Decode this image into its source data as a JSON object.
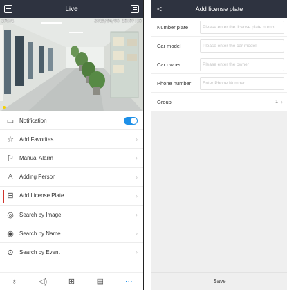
{
  "left": {
    "header": {
      "title": "Live"
    },
    "video": {
      "osd_left": "IPC01",
      "osd_right": "2019/04/06 16:07:55"
    },
    "menu": [
      {
        "label": "Notification",
        "icon": "notification-icon",
        "glyph": "▭"
      },
      {
        "label": "Add Favorites",
        "icon": "star-icon",
        "glyph": "☆"
      },
      {
        "label": "Manual Alarm",
        "icon": "alarm-icon",
        "glyph": "⚐"
      },
      {
        "label": "Adding Person",
        "icon": "person-icon",
        "glyph": "♙"
      },
      {
        "label": "Add License Plate",
        "icon": "car-plate-icon",
        "glyph": "⊟"
      },
      {
        "label": "Search by Image",
        "icon": "image-search-icon",
        "glyph": "◎"
      },
      {
        "label": "Search by Name",
        "icon": "name-search-icon",
        "glyph": "◉"
      },
      {
        "label": "Search by Event",
        "icon": "event-search-icon",
        "glyph": "⊙"
      }
    ],
    "bottombar": [
      {
        "name": "microphone-icon",
        "glyph": "♁"
      },
      {
        "name": "speaker-icon",
        "glyph": "◁)"
      },
      {
        "name": "split-screen-icon",
        "glyph": "⊞"
      },
      {
        "name": "playback-icon",
        "glyph": "▤"
      },
      {
        "name": "more-icon",
        "glyph": "⋯"
      }
    ],
    "accent": "#1e90e8",
    "highlight": "#d0342c"
  },
  "right": {
    "header": {
      "title": "Add license plate",
      "back": "<"
    },
    "fields": [
      {
        "label": "Number plate",
        "placeholder": "Please enter the license plate numb"
      },
      {
        "label": "Car model",
        "placeholder": "Please enter the car model"
      },
      {
        "label": "Car owner",
        "placeholder": "Please enter the owner"
      },
      {
        "label": "Phone number",
        "placeholder": "Enter Phone Number"
      }
    ],
    "group": {
      "label": "Group",
      "value": "1"
    },
    "save_label": "Save"
  }
}
